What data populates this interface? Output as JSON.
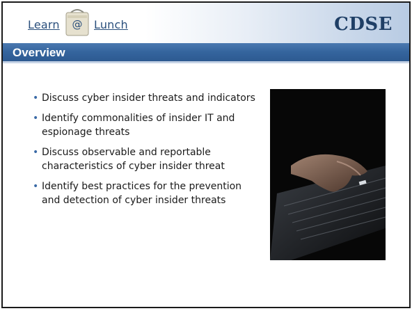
{
  "header": {
    "logo_learn": "Learn",
    "logo_at": "@",
    "logo_lunch": "Lunch",
    "brand": "CDSE"
  },
  "slide": {
    "title": "Overview",
    "bullets": [
      "Discuss cyber insider threats and indicators",
      "Identify commonalities of insider IT and espionage threats",
      "Discuss observable and reportable characteristics of cyber insider threat",
      "Identify best practices for the prevention and detection of cyber insider threats"
    ]
  },
  "colors": {
    "title_bar": "#34649d",
    "brand_text": "#1f3f66",
    "bullet": "#3a6aa6"
  },
  "icons": {
    "logo": "lunchbox-at-icon",
    "photo": "hand-on-keyboard-image"
  }
}
